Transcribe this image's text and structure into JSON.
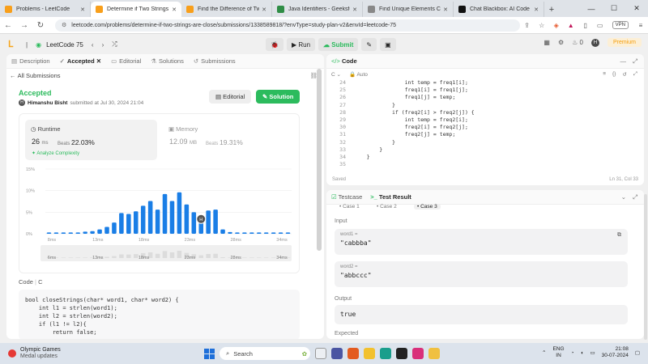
{
  "browser": {
    "tabs": [
      {
        "title": "Problems - LeetCode",
        "color": "#f89f1b"
      },
      {
        "title": "Determine if Two Strings A",
        "color": "#f89f1b"
      },
      {
        "title": "Find the Difference of Two Arra",
        "color": "#f89f1b"
      },
      {
        "title": "Java Identifiers - GeeksforGeeks",
        "color": "#2f8d46"
      },
      {
        "title": "Find Unique Elements C",
        "color": "#888888"
      },
      {
        "title": "Chat Blackbox: AI Code Genera",
        "color": "#111111"
      }
    ],
    "url": "leetcode.com/problems/determine-if-two-strings-are-close/submissions/1338589818/?envType=study-plan-v2&envId=leetcode-75",
    "vpn": "VPN"
  },
  "header": {
    "study_plan": "LeetCode 75",
    "run": "Run",
    "submit": "Submit",
    "fire_count": "0",
    "avatar": "H",
    "premium": "Premium"
  },
  "left_tabs": [
    "Description",
    "Accepted",
    "Editorial",
    "Solutions",
    "Submissions"
  ],
  "back_link": "All Submissions",
  "submission": {
    "status": "Accepted",
    "author_initial": "H",
    "author": "Himanshu Bisht",
    "submitted": "submitted at Jul 30, 2024 21:04",
    "editorial_btn": "Editorial",
    "solution_btn": "Solution",
    "runtime_label": "Runtime",
    "runtime_value": "26",
    "runtime_unit": "ms",
    "beats_label": "Beats",
    "runtime_beats": "22.03%",
    "analyze": "Analyze Complexity",
    "memory_label": "Memory",
    "memory_value": "12.09",
    "memory_unit": "MB",
    "memory_beats": "19.31%"
  },
  "chart_data": {
    "type": "bar",
    "ylabel_ticks": [
      "15%",
      "10%",
      "5%",
      "0%"
    ],
    "ylim": [
      0,
      15
    ],
    "xlabels": [
      "8ms",
      "13ms",
      "18ms",
      "23ms",
      "28ms",
      "34ms"
    ],
    "values": [
      0.3,
      0.3,
      0.3,
      0.3,
      0.3,
      0.5,
      0.6,
      1.0,
      1.6,
      2.6,
      4.8,
      4.6,
      5.2,
      6.5,
      7.6,
      5.6,
      9.2,
      7.6,
      9.6,
      6.8,
      5.0,
      3.6,
      5.4,
      5.6,
      1.0,
      0.4,
      0.3,
      0.3,
      0.3,
      0.3,
      0.3,
      0.3,
      0.3,
      0.3
    ],
    "highlight_index": 21,
    "highlight_label": "H",
    "bar_color": "#1a7ee6",
    "overview_labels": [
      "6ms",
      "13ms",
      "18ms",
      "23ms",
      "28ms",
      "34ms"
    ]
  },
  "code_section": {
    "label": "Code",
    "lang": "C"
  },
  "code_lines": [
    "bool closeStrings(char* word1, char* word2) {",
    "    int l1 = strlen(word1);",
    "    int l2 = strlen(word2);",
    "    if (l1 != l2){",
    "        return false;"
  ],
  "editor": {
    "title": "Code",
    "lang": "C",
    "mode": "Auto",
    "lines": [
      {
        "n": "24",
        "t": "                int temp = freq1[i];"
      },
      {
        "n": "25",
        "t": "                freq1[i] = freq1[j];"
      },
      {
        "n": "26",
        "t": "                freq1[j] = temp;"
      },
      {
        "n": "27",
        "t": "            }"
      },
      {
        "n": "28",
        "t": "            if (freq2[i] > freq2[j]) {"
      },
      {
        "n": "29",
        "t": "                int temp = freq2[i];"
      },
      {
        "n": "30",
        "t": "                freq2[i] = freq2[j];"
      },
      {
        "n": "31",
        "t": "                freq2[j] = temp;"
      },
      {
        "n": "32",
        "t": "            }"
      },
      {
        "n": "33",
        "t": "        }"
      },
      {
        "n": "34",
        "t": "    }"
      },
      {
        "n": "35",
        "t": ""
      }
    ],
    "saved": "Saved",
    "position": "Ln 31, Col 33"
  },
  "results": {
    "testcase_tab": "Testcase",
    "result_tab": "Test Result",
    "cases": [
      "Case 1",
      "Case 2",
      "Case 3"
    ],
    "input_label": "Input",
    "word1_name": "word1 =",
    "word1_val": "\"cabbba\"",
    "word2_name": "word2 =",
    "word2_val": "\"abbccc\"",
    "output_label": "Output",
    "output_val": "true",
    "expected_label": "Expected"
  },
  "taskbar": {
    "news_title": "Olympic Games",
    "news_sub": "Medal updates",
    "search": "Search",
    "lang1": "ENG",
    "lang2": "IN",
    "time": "21:08",
    "date": "30-07-2024"
  }
}
